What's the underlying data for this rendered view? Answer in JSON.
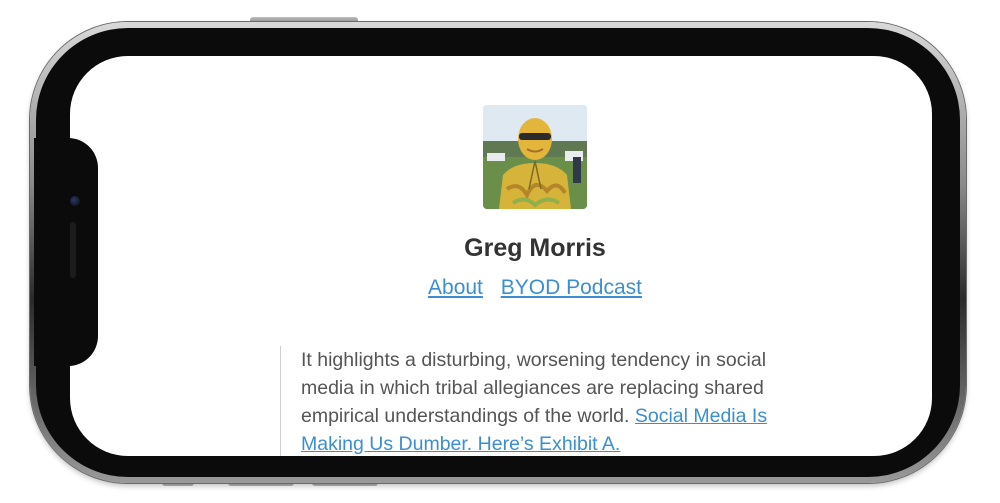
{
  "profile": {
    "name": "Greg Morris"
  },
  "nav": {
    "links": [
      {
        "label": "About"
      },
      {
        "label": "BYOD Podcast"
      }
    ]
  },
  "post": {
    "quote_text": "It highlights a disturbing, worsening tendency in social media in which tribal allegiances are replacing shared empirical understandings of the world.",
    "link_text": "Social Media Is Making Us Dumber. Here’s Exhibit A."
  },
  "colors": {
    "link": "#3b8fd0",
    "name_text": "#333333",
    "body_text": "#555555",
    "phone_bezel": "#0b0b0b"
  },
  "icons": {
    "avatar": "profile-photo",
    "camera": "front-camera-icon"
  }
}
